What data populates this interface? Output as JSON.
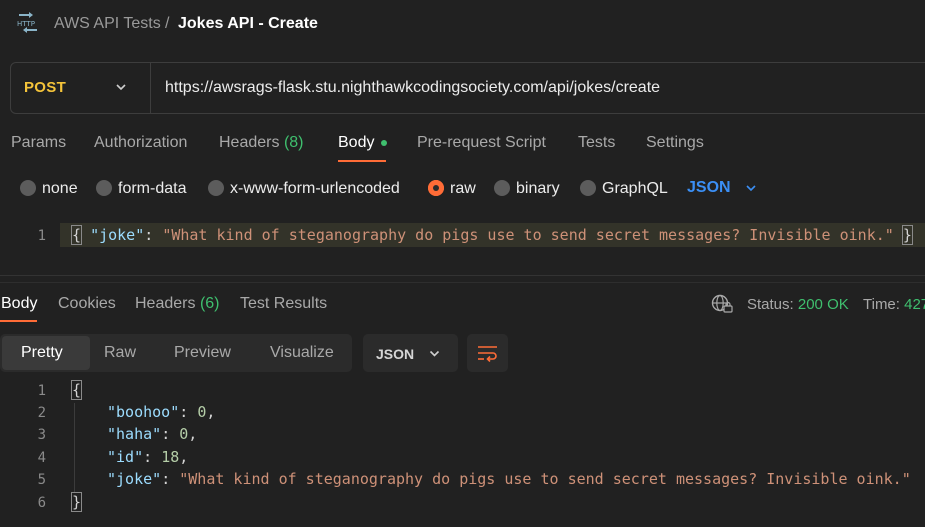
{
  "header": {
    "icon": "http-icon",
    "icon_text": "HTTP",
    "collection": "AWS API Tests",
    "separator": "/",
    "title": "Jokes API - Create"
  },
  "request": {
    "method": "POST",
    "url": "https://awsrags-flask.stu.nighthawkcodingsociety.com/api/jokes/create",
    "tabs": [
      {
        "label": "Params"
      },
      {
        "label": "Authorization"
      },
      {
        "label": "Headers",
        "count": "(8)"
      },
      {
        "label": "Body",
        "active": true
      },
      {
        "label": "Pre-request Script"
      },
      {
        "label": "Tests"
      },
      {
        "label": "Settings"
      }
    ],
    "body_types": [
      {
        "label": "none",
        "selected": false
      },
      {
        "label": "form-data",
        "selected": false
      },
      {
        "label": "x-www-form-urlencoded",
        "selected": false
      },
      {
        "label": "raw",
        "selected": true
      },
      {
        "label": "binary",
        "selected": false
      },
      {
        "label": "GraphQL",
        "selected": false
      }
    ],
    "raw_format": "JSON",
    "body_lines": [
      {
        "num": "1",
        "open": "{",
        "key": "\"joke\"",
        "colon": ": ",
        "value": "\"What kind of steganography do pigs use to send secret messages? Invisible oink.\"",
        "close": "}"
      }
    ]
  },
  "response": {
    "tabs": [
      {
        "label": "Body",
        "active": true
      },
      {
        "label": "Cookies"
      },
      {
        "label": "Headers",
        "count": "(6)"
      },
      {
        "label": "Test Results"
      }
    ],
    "status_label": "Status:",
    "status_value": "200 OK",
    "time_label": "Time:",
    "time_value": "427",
    "view_modes": [
      "Pretty",
      "Raw",
      "Preview",
      "Visualize"
    ],
    "active_view": "Pretty",
    "format": "JSON",
    "lines": [
      {
        "num": "1",
        "text": "{"
      },
      {
        "num": "2",
        "key": "\"boohoo\"",
        "value": "0",
        "trail": ","
      },
      {
        "num": "3",
        "key": "\"haha\"",
        "value": "0",
        "trail": ","
      },
      {
        "num": "4",
        "key": "\"id\"",
        "value": "18",
        "trail": ","
      },
      {
        "num": "5",
        "key": "\"joke\"",
        "value": "\"What kind of steganography do pigs use to send secret messages? Invisible oink.\"",
        "trail": ""
      },
      {
        "num": "6",
        "text": "}"
      }
    ]
  },
  "colors": {
    "accent": "#ff6c37",
    "method_post": "#f5c43a",
    "success": "#3fbf6e",
    "link_blue": "#3b8ff5"
  }
}
